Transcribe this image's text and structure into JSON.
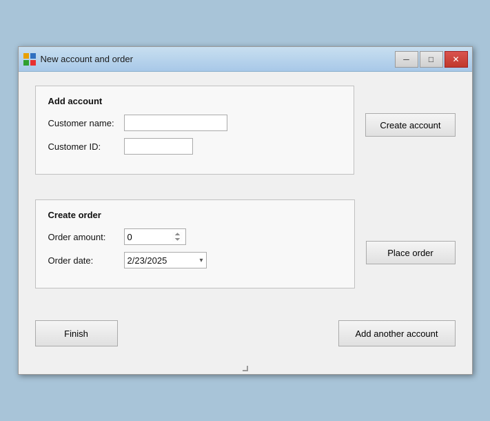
{
  "window": {
    "title": "New account and order",
    "icon": "window-icon"
  },
  "titlebar": {
    "minimize_label": "─",
    "restore_label": "□",
    "close_label": "✕"
  },
  "add_account": {
    "section_label": "Add account",
    "customer_name_label": "Customer name:",
    "customer_name_value": "",
    "customer_name_placeholder": "",
    "customer_id_label": "Customer ID:",
    "customer_id_value": "",
    "create_account_btn": "Create account"
  },
  "create_order": {
    "section_label": "Create order",
    "order_amount_label": "Order amount:",
    "order_amount_value": "0",
    "order_date_label": "Order date:",
    "order_date_value": "2/23/2025",
    "place_order_btn": "Place order"
  },
  "footer": {
    "finish_btn": "Finish",
    "add_another_btn": "Add another account"
  }
}
